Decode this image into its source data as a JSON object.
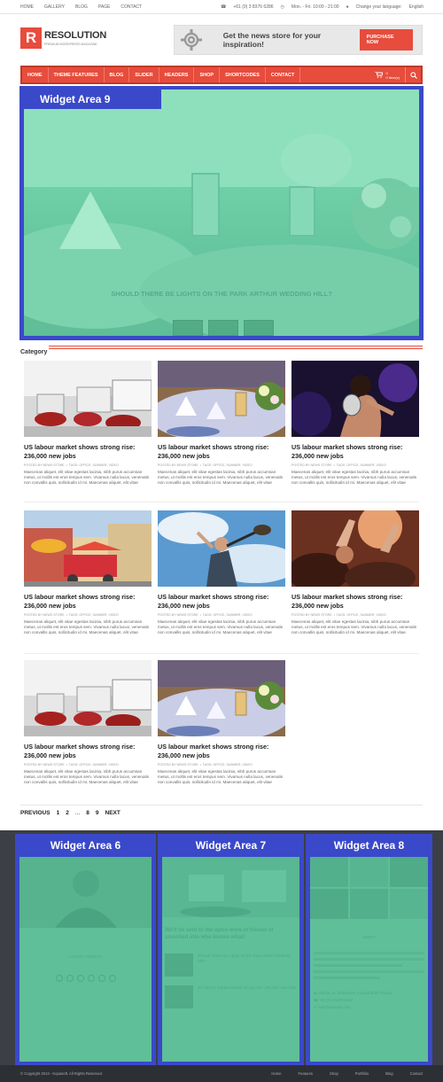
{
  "topbar": {
    "nav": [
      "HOME",
      "GALLERY",
      "BLOG",
      "PAGE",
      "CONTACT"
    ],
    "phone": "+61 (0) 3 8376 6286",
    "hours": "Mon. - Fri. 10:00 - 21:00",
    "language_label": "Change your language:",
    "language_value": "English"
  },
  "header": {
    "logo_letter": "R",
    "logo_name": "RESOLUTION",
    "logo_tagline": "PREMIUM WORDPRESS MAGAZINE",
    "banner_text": "Get the news store for your inspiration!",
    "banner_button": "PURCHASE NOW"
  },
  "navbar": {
    "items": [
      "HOME",
      "THEME FEATURES",
      "BLOG",
      "SLIDER",
      "HEADERS",
      "SHOP",
      "SHORTCODES",
      "CONTACT"
    ],
    "cart_count": "0",
    "cart_label": "0 item(s)"
  },
  "slider": {
    "widget_title": "Widget Area 9",
    "caption": "SHOULD THERE BE LIGHTS ON THE PARK ARTHUR WEDDING HILL?"
  },
  "category": {
    "heading": "Category"
  },
  "posts": [
    {
      "title": "US labour market shows strong rise: 236,000 new jobs",
      "author": "NEWS STORE",
      "tags": "OFFICE, SUMMER, VIDEO",
      "excerpt": "Maecenas aliquet, elit vitae egestas lacinia, nibh purus accumsan metus, ut mollis est eros tempus sem. Vivamus nulla lacus, venenatis non convallis quis, sollicitudin id mi. Maecenas aliquet, elit vitae",
      "image": "office"
    },
    {
      "title": "US labour market shows strong rise: 236,000 new jobs",
      "author": "NEWS STORE",
      "tags": "OFFICE, SUMMER, VIDEO",
      "excerpt": "Maecenas aliquet, elit vitae egestas lacinia, nibh purus accumsan metus, ut mollis est eros tempus sem. Vivamus nulla lacus, venenatis non convallis quis, sollicitudin id mi. Maecenas aliquet, elit vitae",
      "image": "wedding"
    },
    {
      "title": "US labour market shows strong rise: 236,000 new jobs",
      "author": "NEWS STORE",
      "tags": "OFFICE, SUMMER, VIDEO",
      "excerpt": "Maecenas aliquet, elit vitae egestas lacinia, nibh purus accumsan metus, ut mollis est eros tempus sem. Vivamus nulla lacus, venenatis non convallis quis, sollicitudin id mi. Maecenas aliquet, elit vitae",
      "image": "concert"
    },
    {
      "title": "US labour market shows strong rise: 236,000 new jobs",
      "author": "NEWS STORE",
      "tags": "OFFICE, SUMMER, VIDEO",
      "excerpt": "Maecenas aliquet, elit vitae egestas lacinia, nibh purus accumsan metus, ut mollis est eros tempus sem. Vivamus nulla lacus, venenatis non convallis quis, sollicitudin id mi. Maecenas aliquet, elit vitae",
      "image": "street"
    },
    {
      "title": "US labour market shows strong rise: 236,000 new jobs",
      "author": "NEWS STORE",
      "tags": "OFFICE, SUMMER, VIDEO",
      "excerpt": "Maecenas aliquet, elit vitae egestas lacinia, nibh purus accumsan metus, ut mollis est eros tempus sem. Vivamus nulla lacus, venenatis non convallis quis, sollicitudin id mi. Maecenas aliquet, elit vitae",
      "image": "guitar"
    },
    {
      "title": "US labour market shows strong rise: 236,000 new jobs",
      "author": "NEWS STORE",
      "tags": "OFFICE, SUMMER, VIDEO",
      "excerpt": "Maecenas aliquet, elit vitae egestas lacinia, nibh purus accumsan metus, ut mollis est eros tempus sem. Vivamus nulla lacus, venenatis non convallis quis, sollicitudin id mi. Maecenas aliquet, elit vitae",
      "image": "crowd"
    },
    {
      "title": "US labour market shows strong rise: 236,000 new jobs",
      "author": "NEWS STORE",
      "tags": "OFFICE, SUMMER, VIDEO",
      "excerpt": "Maecenas aliquet, elit vitae egestas lacinia, nibh purus accumsan metus, ut mollis est eros tempus sem. Vivamus nulla lacus, venenatis non convallis quis, sollicitudin id mi. Maecenas aliquet, elit vitae",
      "image": "office"
    },
    {
      "title": "US labour market shows strong rise: 236,000 new jobs",
      "author": "NEWS STORE",
      "tags": "OFFICE, SUMMER, VIDEO",
      "excerpt": "Maecenas aliquet, elit vitae egestas lacinia, nibh purus accumsan metus, ut mollis est eros tempus sem. Vivamus nulla lacus, venenatis non convallis quis, sollicitudin id mi. Maecenas aliquet, elit vitae",
      "image": "wedding"
    }
  ],
  "pagination": {
    "prev": "PREVIOUS",
    "pages": [
      "1",
      "2",
      "...",
      "8",
      "9"
    ],
    "next": "NEXT"
  },
  "footer": {
    "widget6": {
      "title": "Widget Area 6",
      "subhead": "LATEST TWEETS"
    },
    "widget7": {
      "title": "Widget Area 7",
      "feature": "We'll be sent to the spice mine of Kessel or smushed into who knows what!",
      "posts": [
        {
          "title": "Should There be Lights on the Park Arthur Climbing Hill?"
        },
        {
          "title": "US labour market shows strong rise: 236,000 new jobs"
        }
      ]
    },
    "widget8": {
      "title": "Widget Area 8",
      "subhead": "ABOUT",
      "address": "Gisborn St, Melbourne, Victoria 3008 Victoria",
      "phone": "+61 (0) 3 8376 6284",
      "email": "mail@example.com"
    }
  },
  "bottom": {
    "copyright": "© Copyright 2013 - Kopasoft. All Rights Reserved.",
    "nav": [
      "Home",
      "Features",
      "Shop",
      "Portfolio",
      "Blog",
      "Contact"
    ]
  },
  "colors": {
    "accent": "#e74c3c",
    "widget_border": "#3a49c9",
    "widget_fill": "#5fbf99",
    "footer_bg": "#3c3f45"
  }
}
